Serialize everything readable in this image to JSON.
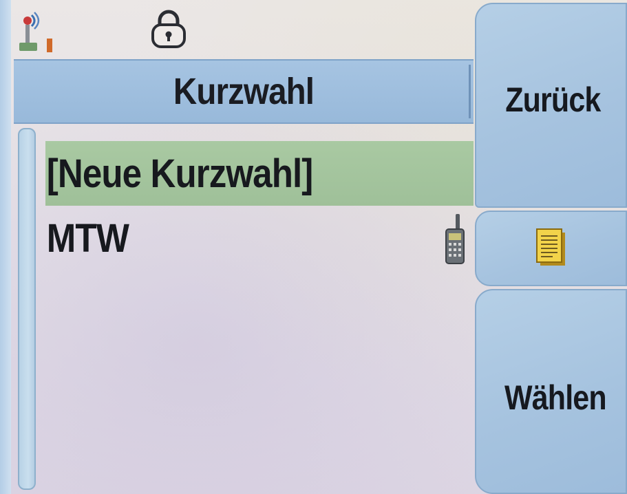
{
  "title_bar": {
    "title": "Kurzwahl"
  },
  "status_bar": {
    "icons": [
      "signal-antenna-icon",
      "lock-icon"
    ]
  },
  "list": {
    "items": [
      {
        "label": "[Neue Kurzwahl]",
        "selected": true
      },
      {
        "label": "MTW",
        "selected": false,
        "icon": "radio-device-icon"
      }
    ]
  },
  "softkeys": {
    "back_label": "Zurück",
    "middle_icon": "notes-icon",
    "select_label": "Wählen"
  },
  "colors": {
    "title_bar": "#a6c4e2",
    "selection": "#a9c9a2",
    "softkey": "#a6c3df",
    "text": "#17191e"
  }
}
